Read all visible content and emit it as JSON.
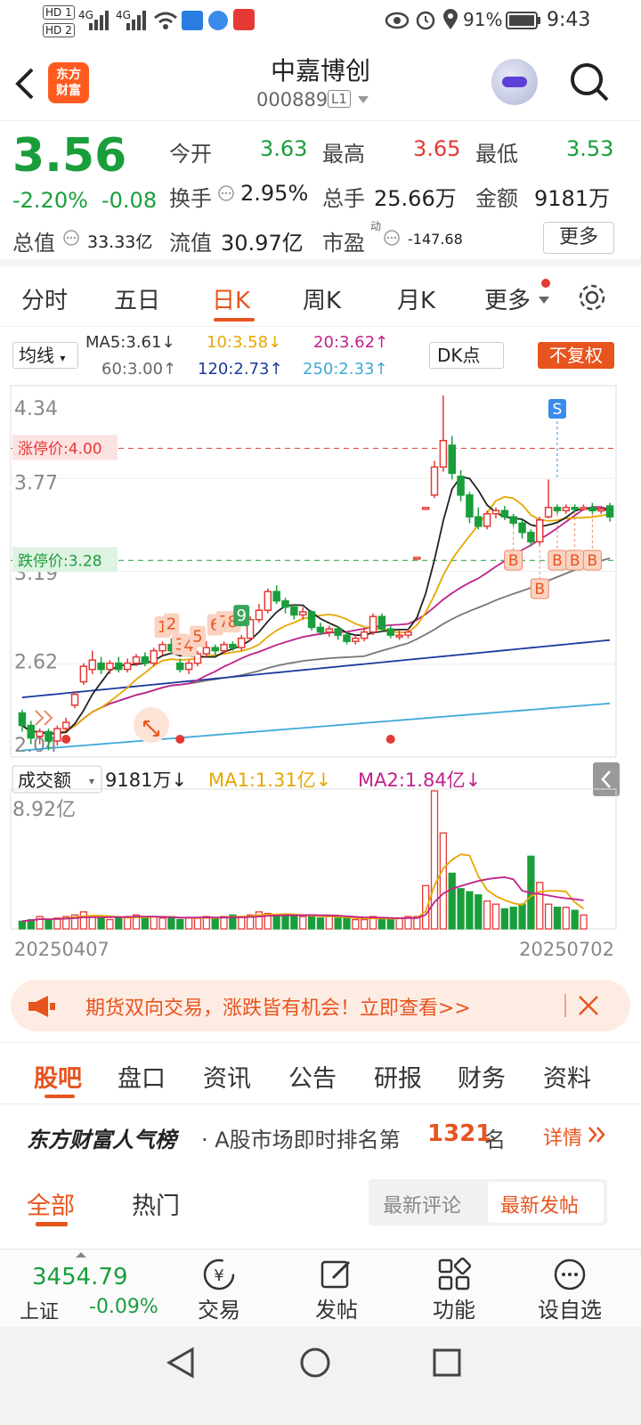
{
  "status": {
    "battery": "91%",
    "time": "9:43",
    "net1": "4G",
    "net2": "4G",
    "hd1": "HD 1",
    "hd2": "HD 2"
  },
  "header": {
    "logo_line1": "东方",
    "logo_line2": "财富",
    "title": "中嘉博创",
    "code": "000889",
    "level": "L1"
  },
  "quote": {
    "price": "3.56",
    "change_pct": "-2.20%",
    "change": "-0.08",
    "open_label": "今开",
    "open": "3.63",
    "high_label": "最高",
    "high": "3.65",
    "low_label": "最低",
    "low": "3.53",
    "turnover_label": "换手",
    "turnover": "2.95%",
    "volume_label": "总手",
    "volume": "25.66万",
    "amount_label": "金额",
    "amount": "9181万",
    "mcap_label": "总值",
    "mcap": "33.33亿",
    "float_label": "流值",
    "float": "30.97亿",
    "pe_label": "市盈",
    "pe_sup": "动",
    "pe": "-147.68",
    "more_button": "更多"
  },
  "ktabs": [
    "分时",
    "五日",
    "日K",
    "周K",
    "月K",
    "更多"
  ],
  "ma": {
    "selector": "均线",
    "ma5": "MA5:3.61↓",
    "ma10": "10:3.58↓",
    "ma20": "20:3.62↑",
    "ma60": "60:3.00↑",
    "ma120": "120:2.73↑",
    "ma250": "250:2.33↑",
    "dk": "DK点",
    "adjust": "不复权"
  },
  "chart_data": [
    {
      "type": "candlestick",
      "y_ticks": [
        "4.34",
        "3.77",
        "3.19",
        "2.62",
        "2.04"
      ],
      "ylim": [
        2.04,
        4.34
      ],
      "limit_up": "涨停价:4.00",
      "limit_down": "跌停价:3.28",
      "x_start": "20250407",
      "x_end": "20250702",
      "markers": [
        "S",
        "B",
        "B",
        "B",
        "B",
        "B"
      ],
      "sequence_labels": [
        "1",
        "2",
        "3",
        "4",
        "5",
        "6",
        "7",
        "8",
        "9"
      ],
      "candles": [
        {
          "o": 2.3,
          "c": 2.22,
          "h": 2.32,
          "l": 2.18
        },
        {
          "o": 2.22,
          "c": 2.14,
          "h": 2.25,
          "l": 2.1
        },
        {
          "o": 2.15,
          "c": 2.18,
          "h": 2.2,
          "l": 2.1
        },
        {
          "o": 2.18,
          "c": 2.12,
          "h": 2.2,
          "l": 2.06
        },
        {
          "o": 2.12,
          "c": 2.2,
          "h": 2.22,
          "l": 2.09
        },
        {
          "o": 2.2,
          "c": 2.24,
          "h": 2.27,
          "l": 2.18
        },
        {
          "o": 2.35,
          "c": 2.42,
          "h": 2.44,
          "l": 2.33
        },
        {
          "o": 2.5,
          "c": 2.6,
          "h": 2.62,
          "l": 2.48
        },
        {
          "o": 2.58,
          "c": 2.64,
          "h": 2.7,
          "l": 2.55
        },
        {
          "o": 2.62,
          "c": 2.58,
          "h": 2.66,
          "l": 2.55
        },
        {
          "o": 2.58,
          "c": 2.62,
          "h": 2.64,
          "l": 2.55
        },
        {
          "o": 2.62,
          "c": 2.58,
          "h": 2.66,
          "l": 2.56
        },
        {
          "o": 2.58,
          "c": 2.62,
          "h": 2.65,
          "l": 2.56
        },
        {
          "o": 2.62,
          "c": 2.66,
          "h": 2.68,
          "l": 2.6
        },
        {
          "o": 2.66,
          "c": 2.62,
          "h": 2.69,
          "l": 2.6
        },
        {
          "o": 2.62,
          "c": 2.7,
          "h": 2.72,
          "l": 2.6
        },
        {
          "o": 2.7,
          "c": 2.74,
          "h": 2.76,
          "l": 2.67
        },
        {
          "o": 2.74,
          "c": 2.7,
          "h": 2.78,
          "l": 2.68
        },
        {
          "o": 2.62,
          "c": 2.58,
          "h": 2.65,
          "l": 2.56
        },
        {
          "o": 2.58,
          "c": 2.62,
          "h": 2.64,
          "l": 2.55
        },
        {
          "o": 2.62,
          "c": 2.68,
          "h": 2.7,
          "l": 2.6
        },
        {
          "o": 2.68,
          "c": 2.72,
          "h": 2.76,
          "l": 2.66
        },
        {
          "o": 2.72,
          "c": 2.7,
          "h": 2.74,
          "l": 2.67
        },
        {
          "o": 2.7,
          "c": 2.74,
          "h": 2.76,
          "l": 2.68
        },
        {
          "o": 2.74,
          "c": 2.72,
          "h": 2.76,
          "l": 2.7
        },
        {
          "o": 2.72,
          "c": 2.78,
          "h": 2.8,
          "l": 2.7
        },
        {
          "o": 2.78,
          "c": 2.9,
          "h": 2.92,
          "l": 2.76
        },
        {
          "o": 2.9,
          "c": 2.96,
          "h": 3.0,
          "l": 2.88
        },
        {
          "o": 2.96,
          "c": 3.08,
          "h": 3.1,
          "l": 2.94
        },
        {
          "o": 3.08,
          "c": 3.02,
          "h": 3.12,
          "l": 3.0
        },
        {
          "o": 3.02,
          "c": 2.98,
          "h": 3.04,
          "l": 2.94
        },
        {
          "o": 2.98,
          "c": 2.93,
          "h": 3.0,
          "l": 2.9
        },
        {
          "o": 2.93,
          "c": 2.95,
          "h": 2.98,
          "l": 2.9
        },
        {
          "o": 2.95,
          "c": 2.85,
          "h": 2.96,
          "l": 2.83
        },
        {
          "o": 2.85,
          "c": 2.82,
          "h": 2.88,
          "l": 2.8
        },
        {
          "o": 2.82,
          "c": 2.84,
          "h": 2.86,
          "l": 2.79
        },
        {
          "o": 2.84,
          "c": 2.8,
          "h": 2.86,
          "l": 2.77
        },
        {
          "o": 2.8,
          "c": 2.76,
          "h": 2.82,
          "l": 2.74
        },
        {
          "o": 2.76,
          "c": 2.78,
          "h": 2.8,
          "l": 2.74
        },
        {
          "o": 2.78,
          "c": 2.82,
          "h": 2.84,
          "l": 2.76
        },
        {
          "o": 2.82,
          "c": 2.92,
          "h": 2.94,
          "l": 2.8
        },
        {
          "o": 2.92,
          "c": 2.84,
          "h": 2.94,
          "l": 2.82
        },
        {
          "o": 2.84,
          "c": 2.8,
          "h": 2.86,
          "l": 2.78
        },
        {
          "o": 2.8,
          "c": 2.8,
          "h": 2.83,
          "l": 2.77
        },
        {
          "o": 2.8,
          "c": 2.82,
          "h": 2.84,
          "l": 2.78
        },
        {
          "o": 3.3,
          "c": 3.3,
          "h": 3.3,
          "l": 3.3
        },
        {
          "o": 3.62,
          "c": 3.62,
          "h": 3.62,
          "l": 3.62
        },
        {
          "o": 3.7,
          "c": 3.88,
          "h": 3.92,
          "l": 3.68
        },
        {
          "o": 3.88,
          "c": 4.05,
          "h": 4.34,
          "l": 3.85
        },
        {
          "o": 4.02,
          "c": 3.84,
          "h": 4.08,
          "l": 3.8
        },
        {
          "o": 3.82,
          "c": 3.7,
          "h": 3.86,
          "l": 3.66
        },
        {
          "o": 3.7,
          "c": 3.56,
          "h": 3.72,
          "l": 3.52
        },
        {
          "o": 3.56,
          "c": 3.5,
          "h": 3.62,
          "l": 3.48
        },
        {
          "o": 3.5,
          "c": 3.58,
          "h": 3.6,
          "l": 3.48
        },
        {
          "o": 3.58,
          "c": 3.6,
          "h": 3.62,
          "l": 3.55
        },
        {
          "o": 3.6,
          "c": 3.56,
          "h": 3.63,
          "l": 3.54
        },
        {
          "o": 3.56,
          "c": 3.52,
          "h": 3.58,
          "l": 3.5
        },
        {
          "o": 3.52,
          "c": 3.46,
          "h": 3.54,
          "l": 3.42
        },
        {
          "o": 3.46,
          "c": 3.4,
          "h": 3.48,
          "l": 3.37
        },
        {
          "o": 3.4,
          "c": 3.54,
          "h": 3.56,
          "l": 3.38
        },
        {
          "o": 3.56,
          "c": 3.62,
          "h": 3.8,
          "l": 3.55
        },
        {
          "o": 3.62,
          "c": 3.6,
          "h": 3.64,
          "l": 3.58
        },
        {
          "o": 3.6,
          "c": 3.62,
          "h": 3.64,
          "l": 3.58
        },
        {
          "o": 3.62,
          "c": 3.61,
          "h": 3.64,
          "l": 3.59
        },
        {
          "o": 3.61,
          "c": 3.62,
          "h": 3.64,
          "l": 3.6
        },
        {
          "o": 3.62,
          "c": 3.6,
          "h": 3.65,
          "l": 3.58
        },
        {
          "o": 3.6,
          "c": 3.61,
          "h": 3.63,
          "l": 3.58
        },
        {
          "o": 3.63,
          "c": 3.56,
          "h": 3.65,
          "l": 3.53
        }
      ]
    },
    {
      "type": "bar",
      "title": "成交额",
      "value_label": "9181万↓",
      "ma1": "MA1:1.31亿↓",
      "ma2": "MA2:1.84亿↓",
      "y_top": "8.92亿",
      "ylim": [
        0,
        8.92
      ],
      "values": [
        0.5,
        0.6,
        0.8,
        0.6,
        0.7,
        0.8,
        0.9,
        1.1,
        0.8,
        0.7,
        0.6,
        0.7,
        0.8,
        0.9,
        0.7,
        0.8,
        0.7,
        0.8,
        0.6,
        0.7,
        0.7,
        0.8,
        0.7,
        0.8,
        0.9,
        0.8,
        0.9,
        1.1,
        1.0,
        0.9,
        0.9,
        0.8,
        0.8,
        0.9,
        0.7,
        0.8,
        0.7,
        0.7,
        0.6,
        0.6,
        0.8,
        0.7,
        0.6,
        0.7,
        0.8,
        0.8,
        2.8,
        8.92,
        6.2,
        3.6,
        2.6,
        2.4,
        2.2,
        1.8,
        1.6,
        1.3,
        1.4,
        1.6,
        4.7,
        3.0,
        1.6,
        1.4,
        1.4,
        1.2,
        0.9
      ]
    }
  ],
  "banner": {
    "text": "期货双向交易，涨跌皆有机会！立即查看>>"
  },
  "btabs": [
    "股吧",
    "盘口",
    "资讯",
    "公告",
    "研报",
    "财务",
    "资料"
  ],
  "rank": {
    "brand": "东方财富人气榜",
    "text_pre": "· A股市场即时排名第",
    "rank_num": "1321",
    "text_post": "名",
    "detail": "详情"
  },
  "subtabs": {
    "all": "全部",
    "hot": "热门",
    "latest_comment": "最新评论",
    "latest_post": "最新发帖"
  },
  "bottomnav": {
    "index_value": "3454.79",
    "index_name": "上证",
    "index_change": "-0.09%",
    "trade": "交易",
    "post": "发帖",
    "func": "功能",
    "watch": "设自选"
  }
}
